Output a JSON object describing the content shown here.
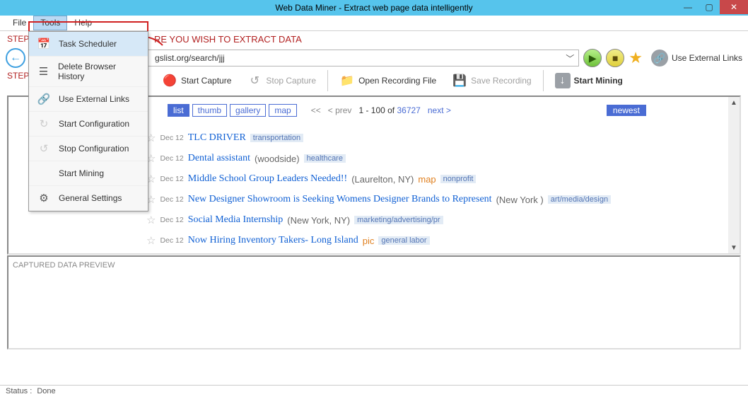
{
  "title": "Web Data Miner -  Extract web page data intelligently",
  "menubar": {
    "file": "File",
    "tools": "Tools",
    "help": "Help"
  },
  "step1": {
    "prefix": "STEP",
    "headline": "RE YOU WISH TO EXTRACT DATA"
  },
  "step2": {
    "prefix": "STEP"
  },
  "url": {
    "text": "gslist.org/search/jjj"
  },
  "ext_links": "Use External Links",
  "toolbar": {
    "start_capture": "Start Capture",
    "stop_capture": "Stop Capture",
    "open_rec": "Open Recording File",
    "save_rec": "Save Recording",
    "start_mining": "Start Mining"
  },
  "tools_menu": {
    "task_scheduler": "Task Scheduler",
    "delete_history": "Delete Browser History",
    "use_ext": "Use External Links",
    "start_cfg": "Start Configuration",
    "stop_cfg": "Stop Configuration",
    "start_mining": "Start Mining",
    "general_settings": "General Settings"
  },
  "views": {
    "list": "list",
    "thumb": "thumb",
    "gallery": "gallery",
    "map": "map"
  },
  "pagination": {
    "first": "<<",
    "prev": "< prev",
    "range_pre": "1 - 100 of ",
    "total": "36727",
    "next": "next >",
    "newest": "newest"
  },
  "listings": [
    {
      "date": "Dec 12",
      "title": "TLC DRIVER",
      "loc": "",
      "pic": "",
      "tags": [
        "transportation"
      ]
    },
    {
      "date": "Dec 12",
      "title": "Dental assistant",
      "loc": "(woodside)",
      "pic": "",
      "tags": [
        "healthcare"
      ]
    },
    {
      "date": "Dec 12",
      "title": "Middle School Group Leaders Needed!!",
      "loc": "(Laurelton, NY)",
      "pic": "map",
      "tags": [
        "nonprofit"
      ]
    },
    {
      "date": "Dec 12",
      "title": "New Designer Showroom is Seeking Womens Designer Brands to Represent",
      "loc": "(New York )",
      "pic": "",
      "tags": [
        "art/media/design"
      ]
    },
    {
      "date": "Dec 12",
      "title": "Social Media Internship",
      "loc": "(New York, NY)",
      "pic": "",
      "tags": [
        "marketing/advertising/pr"
      ]
    },
    {
      "date": "Dec 12",
      "title": "Now Hiring Inventory Takers- Long Island",
      "loc": "",
      "pic": "pic",
      "tags": [
        "general labor"
      ]
    }
  ],
  "preview": {
    "label": "CAPTURED DATA PREVIEW"
  },
  "status": {
    "prefix": "Status :",
    "value": "Done"
  }
}
